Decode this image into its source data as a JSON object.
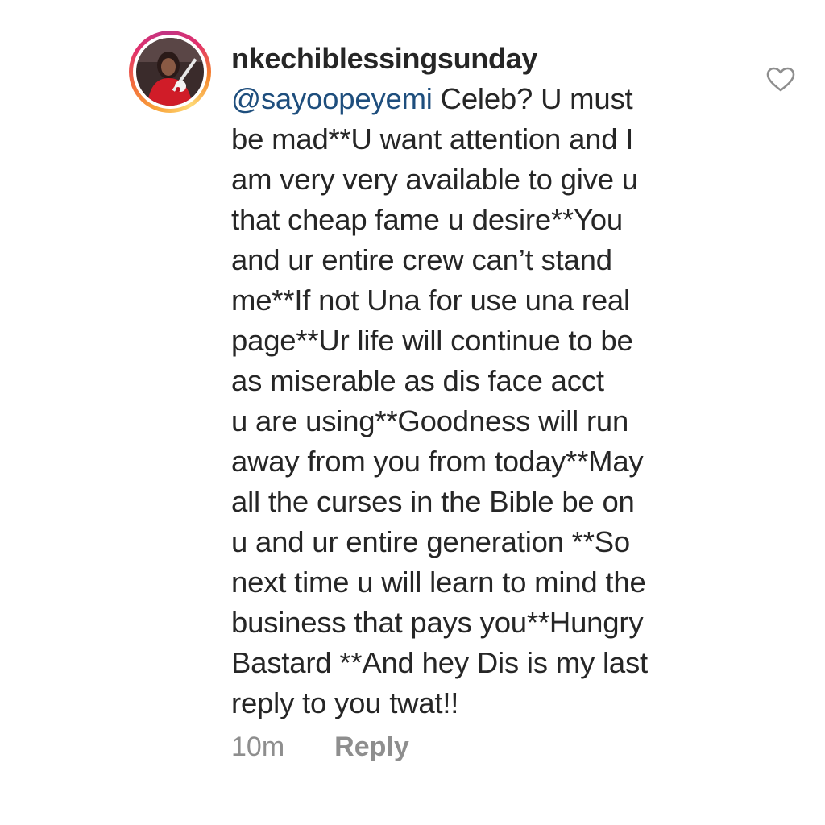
{
  "comment": {
    "username": "nkechiblessingsunday",
    "mention": "@sayoopeyemi",
    "lines": [
      " Celeb? U must",
      "be mad**U want attention and I",
      "am very very available to give u",
      "that cheap fame u desire**You",
      "and ur entire crew can’t stand",
      "me**If not Una for use una real",
      "page**Ur life will continue to be",
      "as miserable as dis face acct",
      "u are using**Goodness will run",
      "away from you from today**May",
      "all the curses in the Bible be on",
      "u and ur entire generation **So",
      "next time u will learn to mind the",
      "business that pays you**Hungry",
      "Bastard **And hey Dis is my last",
      "reply to you twat!!"
    ],
    "time": "10m",
    "reply_label": "Reply",
    "heart_icon": "heart-outline-icon",
    "mention_color": "#1e4e7d",
    "secondary_text_color": "#8e8e8e"
  }
}
